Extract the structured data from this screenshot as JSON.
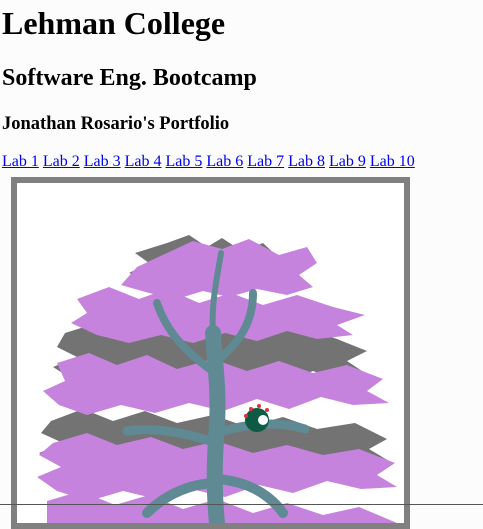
{
  "header": {
    "title": "Lehman College",
    "subtitle": "Software Eng. Bootcamp",
    "author": "Jonathan Rosario's Portfolio"
  },
  "nav": {
    "links": [
      "Lab 1",
      "Lab 2",
      "Lab 3",
      "Lab 4",
      "Lab 5",
      "Lab 6",
      "Lab 7",
      "Lab 8",
      "Lab 9",
      "Lab 10"
    ]
  },
  "artwork": {
    "frame_color": "#808080",
    "foliage_purple": "#c683de",
    "foliage_gray": "#737373",
    "branch_color": "#5f8a94",
    "ornament_color": "#0f5a44",
    "ornament_accent": "#d9343a"
  }
}
